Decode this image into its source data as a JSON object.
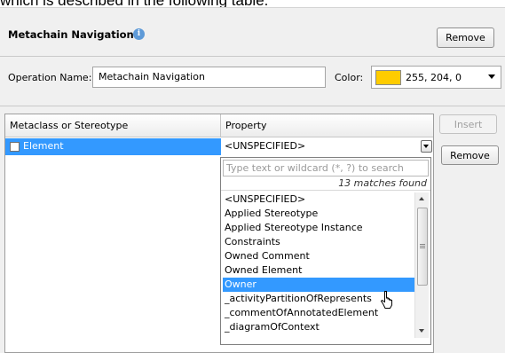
{
  "caption": "which is described in the following table.",
  "header": {
    "title": "Metachain Navigation",
    "remove_label": "Remove"
  },
  "operation": {
    "name_label": "Operation Name:",
    "name_value": "Metachain Navigation",
    "color_label": "Color:",
    "color_value": "255, 204, 0",
    "color_hex": "#ffcc00"
  },
  "table": {
    "col1_header": "Metaclass or Stereotype",
    "col2_header": "Property",
    "row": {
      "element": "Element",
      "property": "<UNSPECIFIED>"
    }
  },
  "dropdown": {
    "search_placeholder": "Type text or wildcard (*, ?) to search",
    "matches": "13 matches found",
    "items": [
      "<UNSPECIFIED>",
      "Applied Stereotype",
      "Applied Stereotype Instance",
      "Constraints",
      "Owned Comment",
      "Owned Element",
      "Owner",
      "_activityPartitionOfRepresents",
      "_commentOfAnnotatedElement",
      "_diagramOfContext"
    ],
    "selected_item": "Owner"
  },
  "side_buttons": {
    "insert_label": "Insert",
    "remove_label": "Remove"
  },
  "colors": {
    "selection": "#3399ff",
    "info_icon": "#5e9ad8"
  }
}
